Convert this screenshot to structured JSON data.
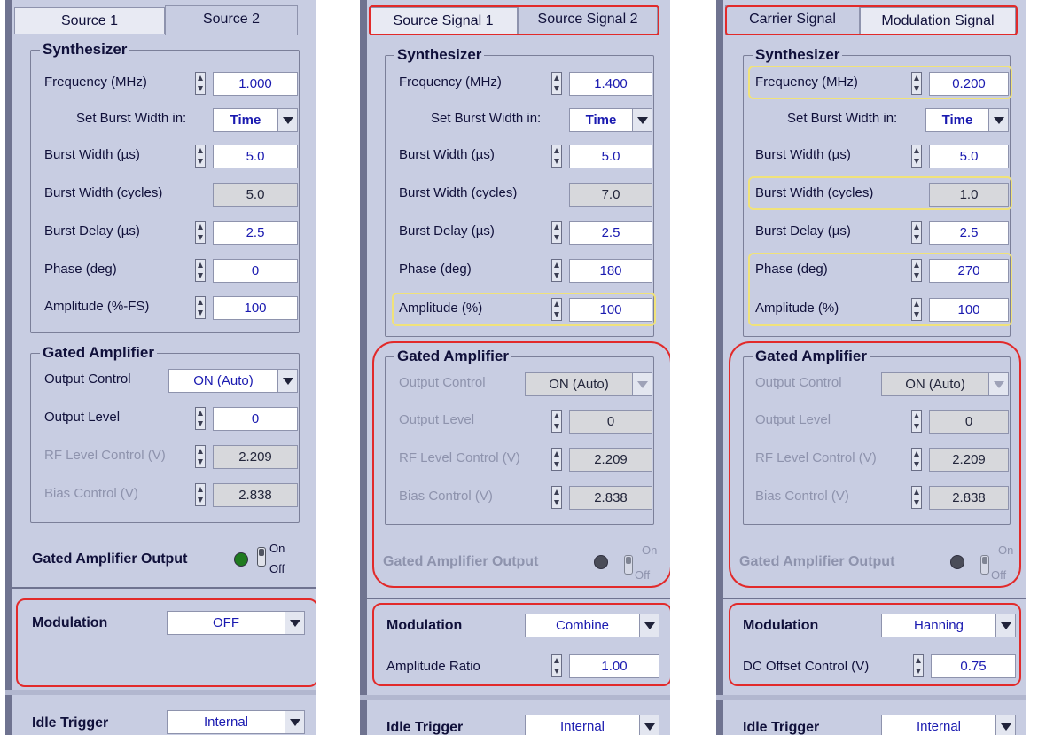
{
  "panels": [
    {
      "tabs": [
        "Source 1",
        "Source 2"
      ],
      "tab_hotkeys": [
        "1",
        "2"
      ],
      "synth_title": "Synthesizer",
      "synth_rows": [
        {
          "label": "Frequency (MHz)",
          "value": "1.000"
        },
        {
          "label": "Set Burst Width in:",
          "value": "Time"
        },
        {
          "label": "Burst Width (µs)",
          "value": "5.0"
        },
        {
          "label": "Burst Width (cycles)",
          "value": "5.0"
        },
        {
          "label": "Burst Delay (µs)",
          "value": "2.5"
        },
        {
          "label": "Phase (deg)",
          "value": "0"
        },
        {
          "label": "Amplitude (%-FS)",
          "value": "100"
        }
      ],
      "amp_title": "Gated Amplifier",
      "amp_rows": [
        {
          "label": "Output Control",
          "value": "ON (Auto)"
        },
        {
          "label": "Output Level",
          "value": "0"
        },
        {
          "label": "RF Level Control (V)",
          "value": "2.209"
        },
        {
          "label": "Bias Control (V)",
          "value": "2.838"
        }
      ],
      "output_label": "Gated Amplifier Output",
      "on_label": "On",
      "off_label": "Off",
      "led_color": "#1f7a1f",
      "modulation_label": "Modulation",
      "modulation_value": "OFF",
      "extra_label": "",
      "extra_value": "",
      "idle_label": "Idle Trigger",
      "idle_value": "Internal"
    },
    {
      "tabs": [
        "Source Signal 1",
        "Source Signal 2"
      ],
      "tab_hotkeys": [
        "1",
        "2"
      ],
      "synth_title": "Synthesizer",
      "synth_rows": [
        {
          "label": "Frequency (MHz)",
          "value": "1.400"
        },
        {
          "label": "Set Burst Width in:",
          "value": "Time"
        },
        {
          "label": "Burst Width (µs)",
          "value": "5.0"
        },
        {
          "label": "Burst Width (cycles)",
          "value": "7.0"
        },
        {
          "label": "Burst Delay (µs)",
          "value": "2.5"
        },
        {
          "label": "Phase (deg)",
          "value": "180"
        },
        {
          "label": "Amplitude (%)",
          "value": "100"
        }
      ],
      "amp_title": "Gated Amplifier",
      "amp_rows": [
        {
          "label": "Output Control",
          "value": "ON (Auto)"
        },
        {
          "label": "Output Level",
          "value": "0"
        },
        {
          "label": "RF Level Control (V)",
          "value": "2.209"
        },
        {
          "label": "Bias Control (V)",
          "value": "2.838"
        }
      ],
      "output_label": "Gated Amplifier Output",
      "on_label": "On",
      "off_label": "Off",
      "led_color": "#4a4c58",
      "modulation_label": "Modulation",
      "modulation_value": "Combine",
      "extra_label": "Amplitude Ratio",
      "extra_value": "1.00",
      "idle_label": "Idle Trigger",
      "idle_value": "Internal"
    },
    {
      "tabs": [
        "Carrier Signal",
        "Modulation Signal"
      ],
      "tab_hotkeys": [
        "",
        ""
      ],
      "synth_title": "Synthesizer",
      "synth_rows": [
        {
          "label": "Frequency (MHz)",
          "value": "0.200"
        },
        {
          "label": "Set Burst Width in:",
          "value": "Time"
        },
        {
          "label": "Burst Width (µs)",
          "value": "5.0"
        },
        {
          "label": "Burst Width (cycles)",
          "value": "1.0"
        },
        {
          "label": "Burst Delay (µs)",
          "value": "2.5"
        },
        {
          "label": "Phase (deg)",
          "value": "270"
        },
        {
          "label": "Amplitude (%)",
          "value": "100"
        }
      ],
      "amp_title": "Gated Amplifier",
      "amp_rows": [
        {
          "label": "Output Control",
          "value": "ON (Auto)"
        },
        {
          "label": "Output Level",
          "value": "0"
        },
        {
          "label": "RF Level Control (V)",
          "value": "2.209"
        },
        {
          "label": "Bias Control (V)",
          "value": "2.838"
        }
      ],
      "output_label": "Gated Amplifier Output",
      "on_label": "On",
      "off_label": "Off",
      "led_color": "#4a4c58",
      "modulation_label": "Modulation",
      "modulation_value": "Hanning",
      "extra_label": "DC Offset Control (V)",
      "extra_value": "0.75",
      "idle_label": "Idle Trigger",
      "idle_value": "Internal"
    }
  ],
  "colors": {
    "panel_bg": "#c8cde2",
    "highlight_red": "#e22a2a",
    "highlight_yellow": "#f0e27a",
    "value_text": "#1a1ab0"
  }
}
